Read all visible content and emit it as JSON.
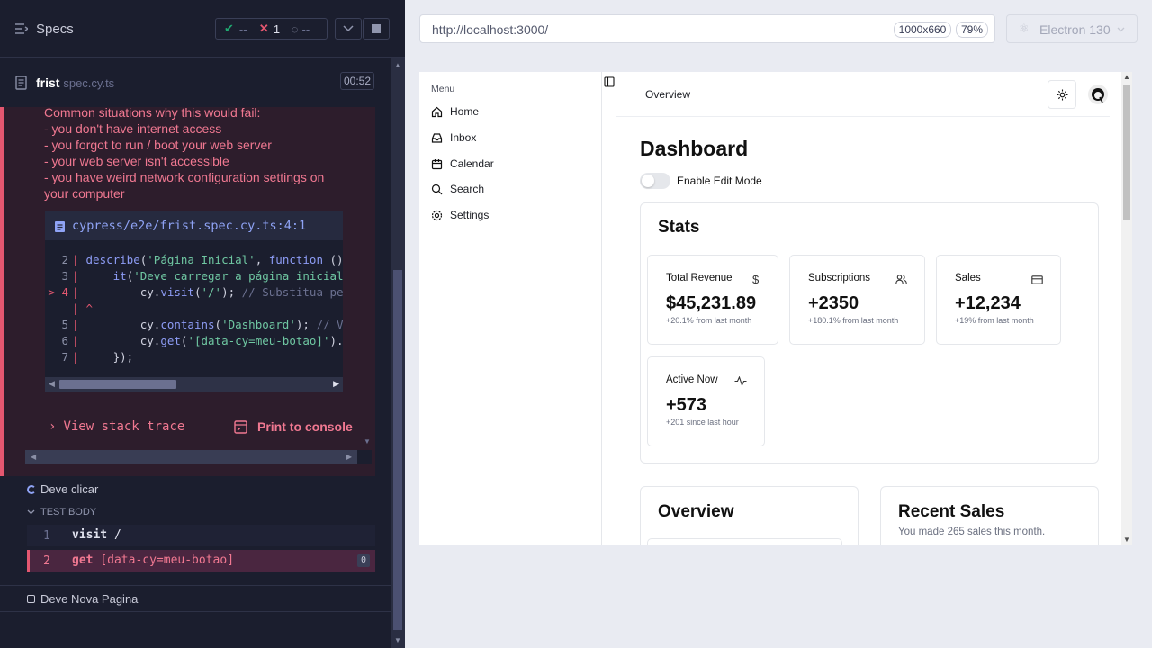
{
  "reporter": {
    "title": "Specs",
    "passed": "--",
    "failed": "1",
    "pending": "--",
    "file_name": "frist",
    "file_ext": "spec.cy.ts",
    "timer": "00:52",
    "error_lines": [
      "Common situations why this would fail:",
      "- you don't have internet access",
      "- you forgot to run / boot your web server",
      "- your web server isn't accessible",
      "- you have weird network configuration settings on your computer"
    ],
    "code_file": "cypress/e2e/frist.spec.cy.ts:4:1",
    "code": [
      {
        "n": "2",
        "text": "describe('Página Inicial', function () {"
      },
      {
        "n": "3",
        "text": "    it('Deve carregar a página inicial', function () {"
      },
      {
        "n": "4",
        "text": "        cy.visit('/'); // Substitua pela URL do seu app"
      },
      {
        "n": "",
        "text": "^"
      },
      {
        "n": "5",
        "text": "        cy.contains('Dashboard'); // Verifica o texto"
      },
      {
        "n": "6",
        "text": "        cy.get('[data-cy=meu-botao]').click();"
      },
      {
        "n": "7",
        "text": "    });"
      }
    ],
    "view_stack": "View stack trace",
    "print_console": "Print to console",
    "test_running": "Deve clicar",
    "test_body_label": "TEST BODY",
    "commands": [
      {
        "n": "1",
        "name": "visit",
        "arg": "/"
      },
      {
        "n": "2",
        "name": "get",
        "arg": "[data-cy=meu-botao]",
        "count": "0"
      }
    ],
    "test_next": "Deve Nova Pagina"
  },
  "browser": {
    "url": "http://localhost:3000/",
    "viewport": "1000x660",
    "zoom": "79%",
    "engine": "Electron 130"
  },
  "app": {
    "menu_label": "Menu",
    "nav": [
      "Home",
      "Inbox",
      "Calendar",
      "Search",
      "Settings"
    ],
    "breadcrumb": "Overview",
    "page_title": "Dashboard",
    "edit_mode_label": "Enable Edit Mode",
    "stats_title": "Stats",
    "cards": [
      {
        "title": "Total Revenue",
        "value": "$45,231.89",
        "sub": "+20.1% from last month",
        "icon": "dollar-icon"
      },
      {
        "title": "Subscriptions",
        "value": "+2350",
        "sub": "+180.1% from last month",
        "icon": "users-icon"
      },
      {
        "title": "Sales",
        "value": "+12,234",
        "sub": "+19% from last month",
        "icon": "credit-card-icon"
      },
      {
        "title": "Active Now",
        "value": "+573",
        "sub": "+201 since last hour",
        "icon": "activity-icon"
      }
    ],
    "overview_title": "Overview",
    "recent_title": "Recent Sales",
    "recent_sub": "You made 265 sales this month."
  }
}
